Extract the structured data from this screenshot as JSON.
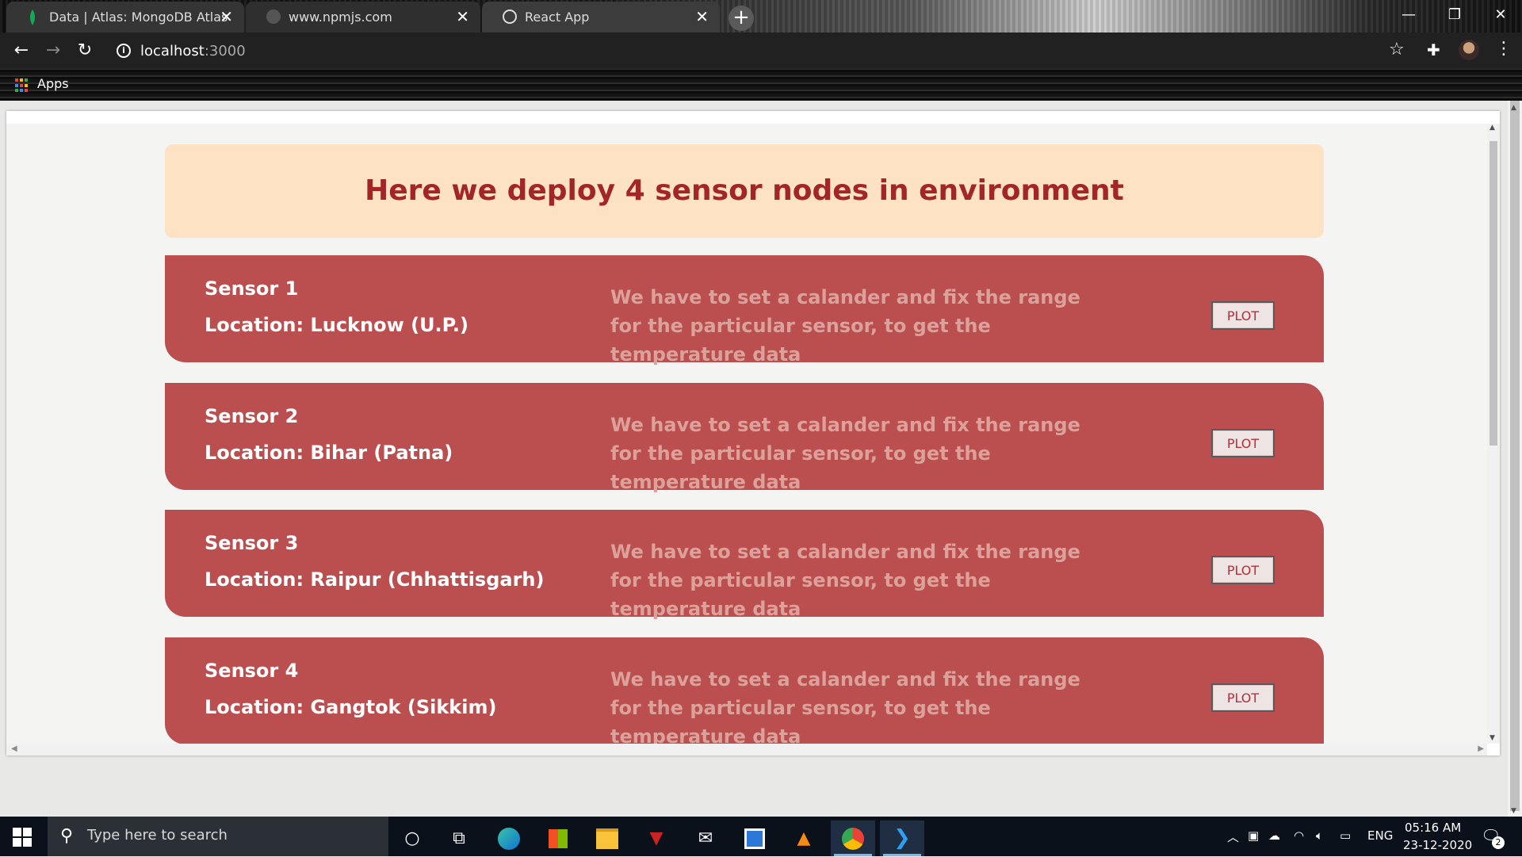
{
  "browser": {
    "tabs": [
      {
        "label": "Data | Atlas: MongoDB Atlas",
        "favicon": "mongodb-leaf-icon"
      },
      {
        "label": "www.npmjs.com",
        "favicon": "globe-icon"
      },
      {
        "label": "React App",
        "favicon": "globe-icon",
        "active": true
      }
    ],
    "new_tab": "+",
    "url_host": "localhost",
    "url_port": ":3000",
    "bookmarks": {
      "apps_label": "Apps"
    }
  },
  "page": {
    "banner_title": "Here we deploy 4 sensor nodes in environment",
    "sensors": [
      {
        "name": "Sensor 1",
        "location": "Location: Lucknow (U.P.)",
        "description": "We have to set a calander and fix the range for the particular sensor, to get the temperature data",
        "button": "PLOT"
      },
      {
        "name": "Sensor 2",
        "location": "Location: Bihar (Patna)",
        "description": "We have to set a calander and fix the range for the particular sensor, to get the temperature data",
        "button": "PLOT"
      },
      {
        "name": "Sensor 3",
        "location": "Location: Raipur (Chhattisgarh)",
        "description": "We have to set a calander and fix the range for the particular sensor, to get the temperature data",
        "button": "PLOT"
      },
      {
        "name": "Sensor 4",
        "location": "Location: Gangtok (Sikkim)",
        "description": "We have to set a calander and fix the range for the particular sensor, to get the temperature data",
        "button": "PLOT"
      }
    ],
    "colors": {
      "banner_bg": "#fde2c3",
      "banner_text": "#a32626",
      "card_bg": "#bb4f4f",
      "desc_text": "#dca19a"
    }
  },
  "taskbar": {
    "search_placeholder": "Type here to search",
    "apps": [
      "cortana-icon",
      "task-view-icon",
      "edge-icon",
      "store-icon",
      "file-explorer-icon",
      "predator-sense-icon",
      "mail-icon",
      "jetbrains-icon",
      "vlc-icon",
      "chrome-icon",
      "vscode-icon"
    ],
    "language": "ENG",
    "time": "05:16 AM",
    "date": "23-12-2020",
    "notification_count": "2"
  }
}
